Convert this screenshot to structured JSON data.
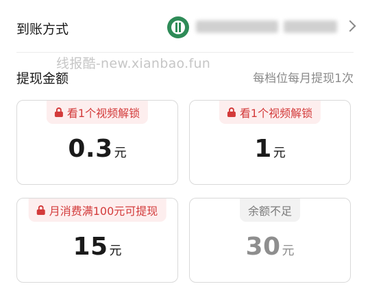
{
  "account": {
    "label": "到账方式",
    "bank_icon": "bank-logo-icon",
    "chevron_icon": "chevron-right-icon"
  },
  "watermark": "线报酷-new.xianbao.fun",
  "withdraw": {
    "title": "提现金额",
    "note": "每档位每月提现1次"
  },
  "options": [
    {
      "tag": "看1个视频解锁",
      "value": "0.3",
      "unit": "元",
      "state": "locked"
    },
    {
      "tag": "看1个视频解锁",
      "value": "1",
      "unit": "元",
      "state": "locked"
    },
    {
      "tag": "月消费满100元可提现",
      "value": "15",
      "unit": "元",
      "state": "locked"
    },
    {
      "tag": "余额不足",
      "value": "30",
      "unit": "元",
      "state": "insufficient"
    }
  ],
  "colors": {
    "lock_red": "#d33a3a",
    "lock_tag_bg": "#fdeeee",
    "muted_tag_bg": "#f2f2f2",
    "bank_green": "#2e8b57"
  }
}
